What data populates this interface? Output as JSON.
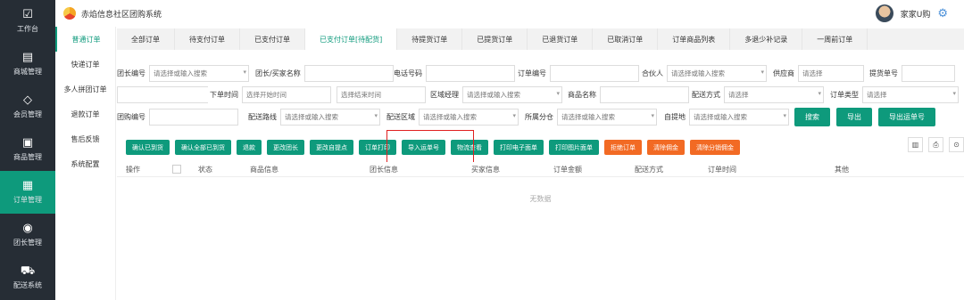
{
  "app": {
    "title": "赤焰信息社区团购系统",
    "username": "家家U购"
  },
  "sidebar": {
    "items": [
      {
        "label": "工作台",
        "icon": "dashboard-icon",
        "glyph": "☑"
      },
      {
        "label": "商城管理",
        "icon": "store-icon",
        "glyph": "▤"
      },
      {
        "label": "会员管理",
        "icon": "vip-icon",
        "glyph": "◇"
      },
      {
        "label": "商品管理",
        "icon": "bag-icon",
        "glyph": "▣"
      },
      {
        "label": "订单管理",
        "icon": "order-icon",
        "glyph": "▦"
      },
      {
        "label": "团长管理",
        "icon": "leader-icon",
        "glyph": "◉"
      },
      {
        "label": "配送系统",
        "icon": "cart-icon",
        "glyph": "⛟"
      }
    ]
  },
  "subnav": {
    "items": [
      "普通订单",
      "快递订单",
      "多人拼团订单",
      "退款订单",
      "售后反馈",
      "系统配置"
    ]
  },
  "tabs": [
    "全部订单",
    "待支付订单",
    "已支付订单",
    "已支付订单[待配货]",
    "待提货订单",
    "已提货订单",
    "已退货订单",
    "已取消订单",
    "订单商品列表",
    "多退少补记录",
    "一周前订单"
  ],
  "filters": {
    "leader_no": {
      "label": "团长编号",
      "placeholder": "请选择或输入搜索"
    },
    "leader_name": {
      "label": "团长/买家名称"
    },
    "phone": {
      "label": "电话号码"
    },
    "order_no": {
      "label": "订单编号"
    },
    "partner": {
      "label": "合伙人",
      "placeholder": "请选择或输入搜索"
    },
    "supplier": {
      "label": "供应商",
      "placeholder": "请选择"
    },
    "pickup_no": {
      "label": "提货单号"
    },
    "order_time": {
      "label": "下单时间",
      "start_placeholder": "选择开始时间",
      "end_placeholder": "选择结束时间"
    },
    "area_manager": {
      "label": "区域经理",
      "placeholder": "请选择或输入搜索"
    },
    "product_name": {
      "label": "商品名称"
    },
    "delivery_method": {
      "label": "配送方式",
      "placeholder": "请选择"
    },
    "order_type": {
      "label": "订单类型",
      "placeholder": "请选择"
    },
    "group_no": {
      "label": "团购编号"
    },
    "delivery_route": {
      "label": "配送路线",
      "placeholder": "请选择或输入搜索"
    },
    "delivery_area": {
      "label": "配送区域",
      "placeholder": "请选择或输入搜索"
    },
    "branch": {
      "label": "所属分仓",
      "placeholder": "请选择或输入搜索"
    },
    "pickup_point": {
      "label": "自提地",
      "placeholder": "请选择或输入搜索"
    },
    "search_btn": "搜索",
    "export_btn": "导出",
    "export_waybill_btn": "导出运单号"
  },
  "actions": [
    "确认已到货",
    "确认全部已到货",
    "退款",
    "更改团长",
    "更改自提点",
    "订单打印",
    "导入运单号",
    "物流查看",
    "打印电子面单",
    "打印图片面单",
    "拒绝订单",
    "清除佣金",
    "清除分销佣金"
  ],
  "table": {
    "columns": [
      "操作",
      "状态",
      "商品信息",
      "团长信息",
      "买家信息",
      "订单金额",
      "配送方式",
      "订单时间",
      "其他"
    ],
    "empty_text": "无数据"
  },
  "colors": {
    "accent": "#0e9a7c",
    "sidebar": "#262d35",
    "danger": "#f26a24",
    "highlight": "#e02020"
  }
}
